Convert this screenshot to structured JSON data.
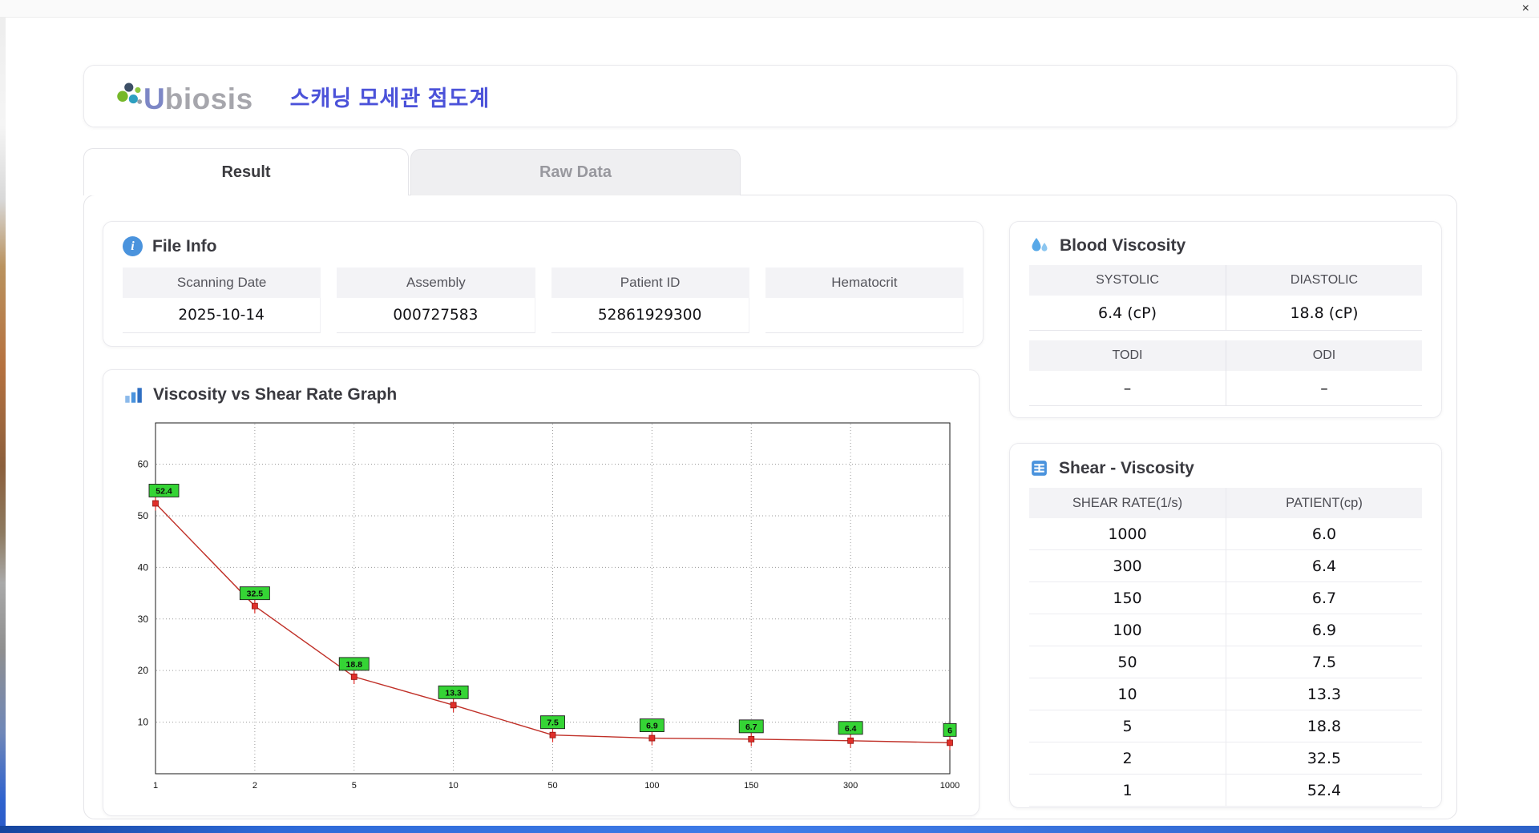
{
  "window": {
    "close_glyph": "×"
  },
  "header": {
    "logo_u": "U",
    "logo_rest": "biosis",
    "title": "스캐닝 모세관 점도계"
  },
  "tabs": [
    {
      "label": "Result",
      "active": true
    },
    {
      "label": "Raw Data",
      "active": false
    }
  ],
  "file_info": {
    "title": "File Info",
    "fields": [
      {
        "label": "Scanning Date",
        "value": "2025-10-14"
      },
      {
        "label": "Assembly",
        "value": "000727583"
      },
      {
        "label": "Patient ID",
        "value": "52861929300"
      },
      {
        "label": "Hematocrit",
        "value": ""
      }
    ]
  },
  "graph": {
    "title": "Viscosity vs Shear Rate Graph"
  },
  "blood_viscosity": {
    "title": "Blood Viscosity",
    "row1_labels": [
      "SYSTOLIC",
      "DIASTOLIC"
    ],
    "row1_values": [
      "6.4 (cP)",
      "18.8 (cP)"
    ],
    "row2_labels": [
      "TODI",
      "ODI"
    ],
    "row2_values": [
      "–",
      "–"
    ]
  },
  "shear_viscosity": {
    "title": "Shear - Viscosity",
    "columns": [
      "SHEAR RATE(1/s)",
      "PATIENT(cp)"
    ],
    "rows": [
      {
        "shear": "1000",
        "patient": "6.0",
        "highlight": false
      },
      {
        "shear": "300",
        "patient": "6.4",
        "highlight": true
      },
      {
        "shear": "150",
        "patient": "6.7",
        "highlight": false
      },
      {
        "shear": "100",
        "patient": "6.9",
        "highlight": false
      },
      {
        "shear": "50",
        "patient": "7.5",
        "highlight": false
      },
      {
        "shear": "10",
        "patient": "13.3",
        "highlight": false
      },
      {
        "shear": "5",
        "patient": "18.8",
        "highlight": true
      },
      {
        "shear": "2",
        "patient": "32.5",
        "highlight": false
      },
      {
        "shear": "1",
        "patient": "52.4",
        "highlight": false
      }
    ]
  },
  "chart_data": {
    "type": "line",
    "title": "",
    "xlabel": "",
    "ylabel": "",
    "x_axis_type": "category",
    "x_categories": [
      "1",
      "2",
      "5",
      "10",
      "50",
      "100",
      "150",
      "300",
      "1000"
    ],
    "values": [
      52.4,
      32.5,
      18.8,
      13.3,
      7.5,
      6.9,
      6.7,
      6.4,
      6.0
    ],
    "point_labels": [
      "52.4",
      "32.5",
      "18.8",
      "13.3",
      "7.5",
      "6.9",
      "6.7",
      "6.4",
      "6"
    ],
    "y_ticks": [
      10,
      20,
      30,
      40,
      50,
      60
    ],
    "ylim": [
      0,
      68
    ],
    "grid": true,
    "legend": false,
    "line_color": "#c03028",
    "marker_color": "#e02f2a",
    "label_bg": "#35d435",
    "label_border": "#1c1c1c"
  },
  "colors": {
    "accent_blue": "#4a93dd",
    "title_indigo": "#4b52d9",
    "highlight_red": "#cc2b2b"
  }
}
